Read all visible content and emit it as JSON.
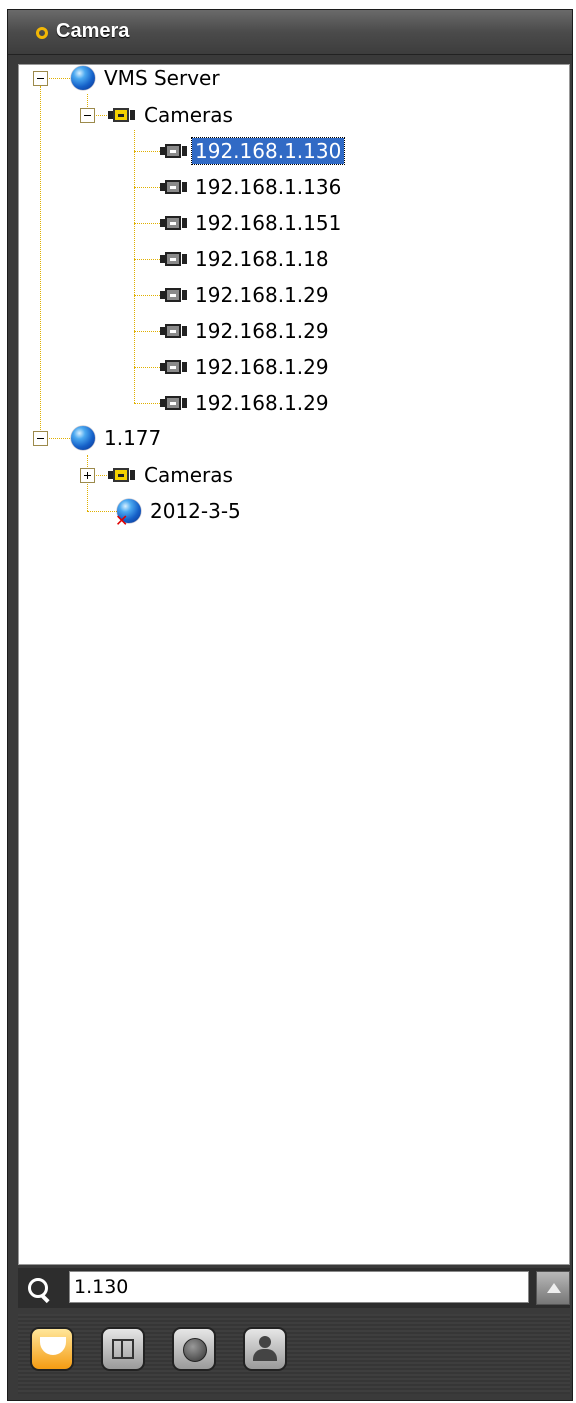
{
  "panel": {
    "title": "Camera"
  },
  "tree": {
    "servers": [
      {
        "label": "VMS Server",
        "folder": "Cameras",
        "cameras": [
          "192.168.1.130",
          "192.168.1.136",
          "192.168.1.151",
          "192.168.1.18",
          "192.168.1.29",
          "192.168.1.29",
          "192.168.1.29",
          "192.168.1.29"
        ],
        "selected": "192.168.1.130"
      },
      {
        "label": "1.177",
        "folder": "Cameras",
        "child_offline": "2012-3-5"
      }
    ]
  },
  "search": {
    "value": "1.130"
  },
  "toolbar": {
    "buttons": [
      {
        "icon": "dome-camera-icon",
        "active": true
      },
      {
        "icon": "layout-icon",
        "active": false
      },
      {
        "icon": "map-globe-icon",
        "active": false
      },
      {
        "icon": "user-icon",
        "active": false
      }
    ]
  },
  "colors": {
    "selection": "#316ac5",
    "accent": "#f2b705",
    "tree_line": "#e0b000"
  }
}
